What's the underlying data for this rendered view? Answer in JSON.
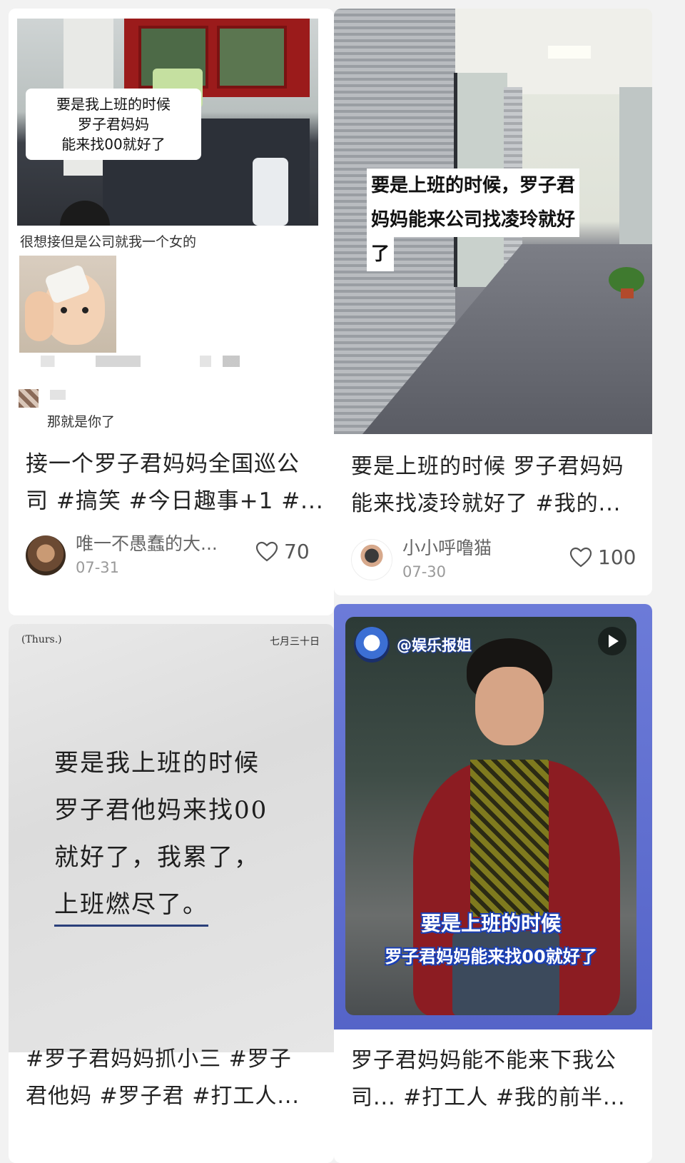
{
  "posts": [
    {
      "image": {
        "overlay_lines": [
          "要是我上班的时候",
          "罗子君妈妈",
          "能来找00就好了"
        ],
        "post_text": "很想接但是公司就我一个女的",
        "reply": "那就是你了"
      },
      "caption_lines": [
        "接一个罗子君妈妈全国巡公",
        "司 #搞笑  #今日趣事+1  #..."
      ],
      "author": "唯一不愚蠢的大...",
      "date": "07-31",
      "likes": "70"
    },
    {
      "image": {
        "overlay_lines": [
          "要是上班的时候，罗子君",
          "妈妈能来公司找凌玲就好",
          "了"
        ]
      },
      "caption_lines": [
        "要是上班的时候 罗子君妈妈",
        "能来找凌玲就好了 #我的..."
      ],
      "author": "小小呼噜猫",
      "date": "07-30",
      "likes": "100"
    },
    {
      "image": {
        "corner_left": "(Thurs.)",
        "corner_right": "七月三十日",
        "poem_lines": [
          "要是我上班的时候",
          "罗子君他妈来找00",
          "就好了，我累了，",
          "上班燃尽了。"
        ]
      },
      "caption_lines": [
        "#罗子君妈妈抓小三 #罗子",
        "君他妈 #罗子君 #打工人..."
      ]
    },
    {
      "image": {
        "account": "@娱乐报姐",
        "subtitle_line1": "要是上班的时候",
        "subtitle_line2": "罗子君妈妈能来找00就好了"
      },
      "caption_lines": [
        "罗子君妈妈能不能来下我公",
        "司... #打工人 #我的前半..."
      ]
    }
  ]
}
